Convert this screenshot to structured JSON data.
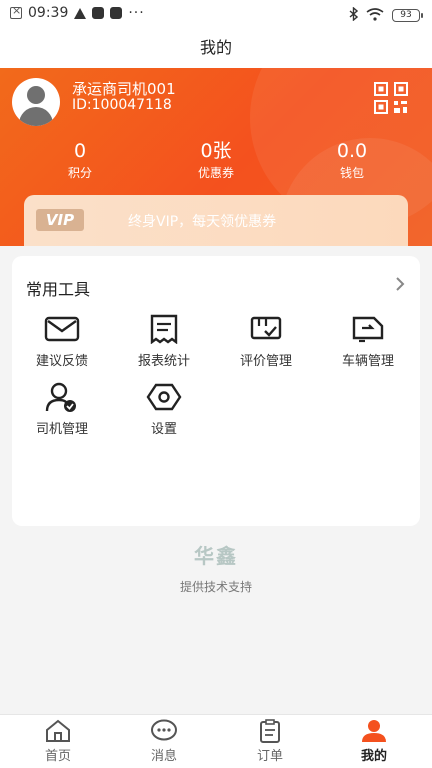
{
  "status_bar": {
    "time": "09:39",
    "battery": "93"
  },
  "title": "我的",
  "user": {
    "name": "承运商司机001",
    "id": "ID:100047118"
  },
  "stats": [
    {
      "value": "0",
      "label": "积分"
    },
    {
      "value": "0张",
      "label": "优惠券"
    },
    {
      "value": "0.0",
      "label": "钱包"
    }
  ],
  "vip": {
    "badge": "VIP",
    "text": "终身VIP，每天领优惠券"
  },
  "tools": {
    "title": "常用工具",
    "items": [
      {
        "label": "建议反馈",
        "icon": "mail-icon"
      },
      {
        "label": "报表统计",
        "icon": "receipt-icon"
      },
      {
        "label": "评价管理",
        "icon": "rating-icon"
      },
      {
        "label": "车辆管理",
        "icon": "truck-icon"
      },
      {
        "label": "司机管理",
        "icon": "driver-icon"
      },
      {
        "label": "设置",
        "icon": "settings-icon"
      }
    ]
  },
  "brand": "华鑫",
  "support_text": "提供技术支持",
  "nav": [
    {
      "label": "首页",
      "icon": "home-icon"
    },
    {
      "label": "消息",
      "icon": "message-icon"
    },
    {
      "label": "订单",
      "icon": "order-icon"
    },
    {
      "label": "我的",
      "icon": "profile-icon",
      "active": true
    }
  ],
  "colors": {
    "accent": "#f4511e",
    "vip_bg": "#fbe0c9",
    "vip_badge": "#d9b292"
  }
}
